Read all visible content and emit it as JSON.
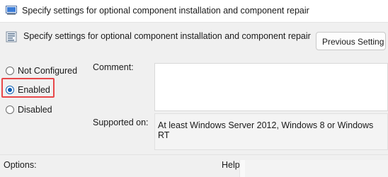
{
  "window": {
    "title": "Specify settings for optional component installation and component repair"
  },
  "header": {
    "title": "Specify settings for optional component installation and component repair",
    "previous_button": "Previous Setting"
  },
  "state": {
    "options": [
      {
        "label": "Not Configured",
        "checked": false
      },
      {
        "label": "Enabled",
        "checked": true
      },
      {
        "label": "Disabled",
        "checked": false
      }
    ]
  },
  "comment": {
    "label": "Comment:",
    "value": ""
  },
  "supported": {
    "label": "Supported on:",
    "value": "At least Windows Server 2012, Windows 8 or Windows RT"
  },
  "bottom": {
    "options_label": "Options:",
    "help_label": "Help:"
  }
}
